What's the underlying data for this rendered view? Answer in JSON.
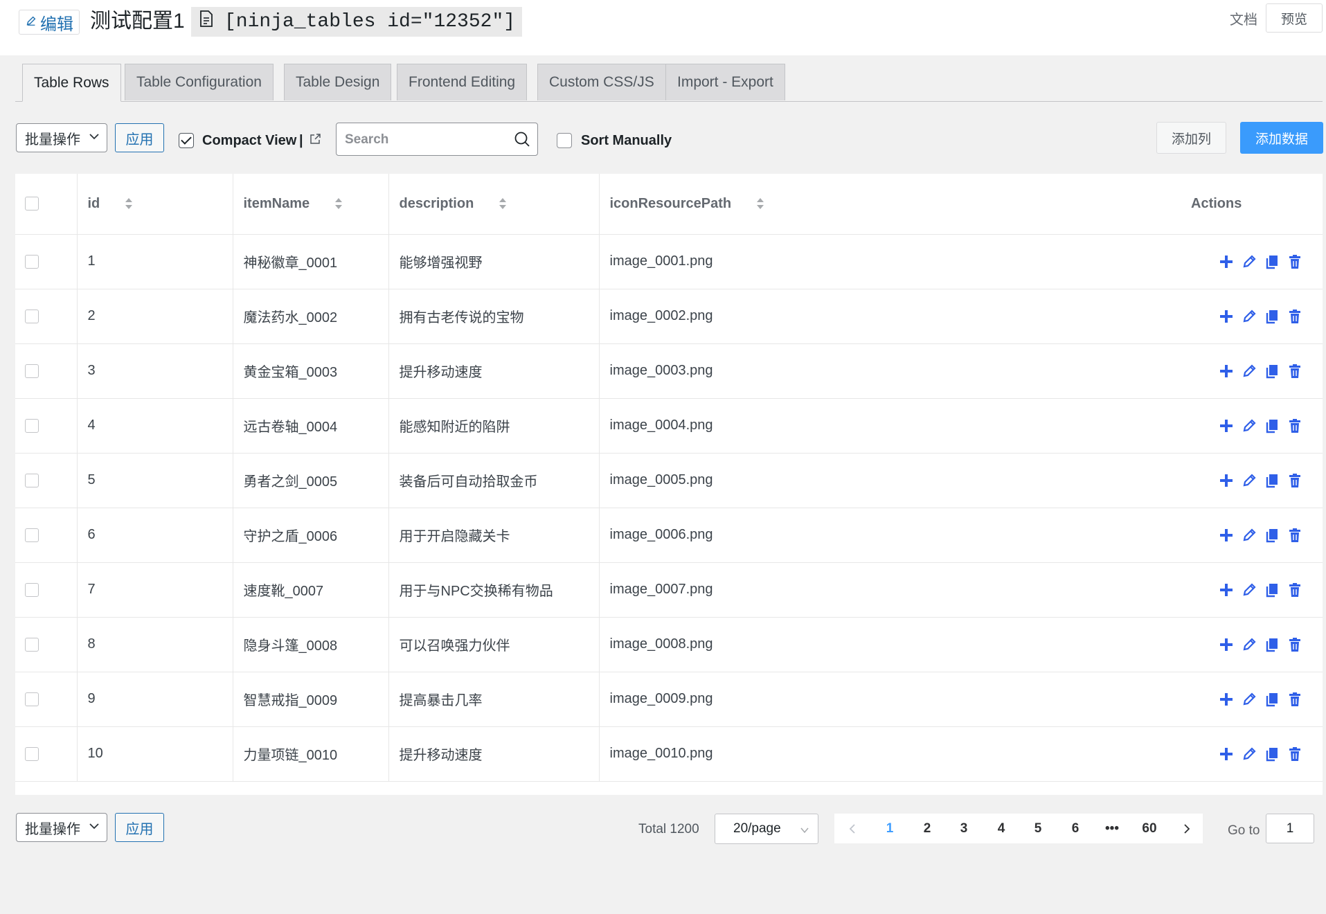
{
  "header": {
    "edit_label": "编辑",
    "table_title": "测试配置1",
    "shortcode": "[ninja_tables id=\"12352\"]",
    "docs_label": "文档",
    "preview_label": "预览"
  },
  "tabs": [
    {
      "label": "Table Rows",
      "active": true
    },
    {
      "label": "Table Configuration"
    },
    {
      "label": "Table Design"
    },
    {
      "label": "Frontend Editing"
    },
    {
      "label": "Custom CSS/JS"
    },
    {
      "label": "Import - Export"
    }
  ],
  "toolbar": {
    "bulk_label": "批量操作",
    "apply_label": "应用",
    "compact_view_label": "Compact View",
    "compact_view_separator": "|",
    "compact_view_checked": true,
    "search_placeholder": "Search",
    "sort_manually_label": "Sort Manually",
    "sort_manually_checked": false,
    "add_column_label": "添加列",
    "add_data_label": "添加数据"
  },
  "table": {
    "columns": [
      "id",
      "itemName",
      "description",
      "iconResourcePath"
    ],
    "actions_header": "Actions",
    "rows": [
      {
        "id": "1",
        "itemName": "神秘徽章_0001",
        "description": "能够增强视野",
        "iconResourcePath": "image_0001.png"
      },
      {
        "id": "2",
        "itemName": "魔法药水_0002",
        "description": "拥有古老传说的宝物",
        "iconResourcePath": "image_0002.png"
      },
      {
        "id": "3",
        "itemName": "黄金宝箱_0003",
        "description": "提升移动速度",
        "iconResourcePath": "image_0003.png"
      },
      {
        "id": "4",
        "itemName": "远古卷轴_0004",
        "description": "能感知附近的陷阱",
        "iconResourcePath": "image_0004.png"
      },
      {
        "id": "5",
        "itemName": "勇者之剑_0005",
        "description": "装备后可自动拾取金币",
        "iconResourcePath": "image_0005.png"
      },
      {
        "id": "6",
        "itemName": "守护之盾_0006",
        "description": "用于开启隐藏关卡",
        "iconResourcePath": "image_0006.png"
      },
      {
        "id": "7",
        "itemName": "速度靴_0007",
        "description": "用于与NPC交换稀有物品",
        "iconResourcePath": "image_0007.png"
      },
      {
        "id": "8",
        "itemName": "隐身斗篷_0008",
        "description": "可以召唤强力伙伴",
        "iconResourcePath": "image_0008.png"
      },
      {
        "id": "9",
        "itemName": "智慧戒指_0009",
        "description": "提高暴击几率",
        "iconResourcePath": "image_0009.png"
      },
      {
        "id": "10",
        "itemName": "力量项链_0010",
        "description": "提升移动速度",
        "iconResourcePath": "image_0010.png"
      }
    ],
    "row_action_icons": [
      "plus-icon",
      "pencil-icon",
      "copy-icon",
      "trash-icon"
    ]
  },
  "footer": {
    "bulk_label": "批量操作",
    "apply_label": "应用",
    "total_text": "Total 1200",
    "page_size_label": "20/page",
    "pages": [
      "1",
      "2",
      "3",
      "4",
      "5",
      "6",
      "•••",
      "60"
    ],
    "current_page": "1",
    "goto_label": "Go to",
    "goto_value": "1"
  },
  "colors": {
    "accent_blue": "#3a9bfc",
    "action_icon_blue": "#2f5fe8",
    "link_blue": "#2271b1",
    "pager_active": "#409eff"
  }
}
